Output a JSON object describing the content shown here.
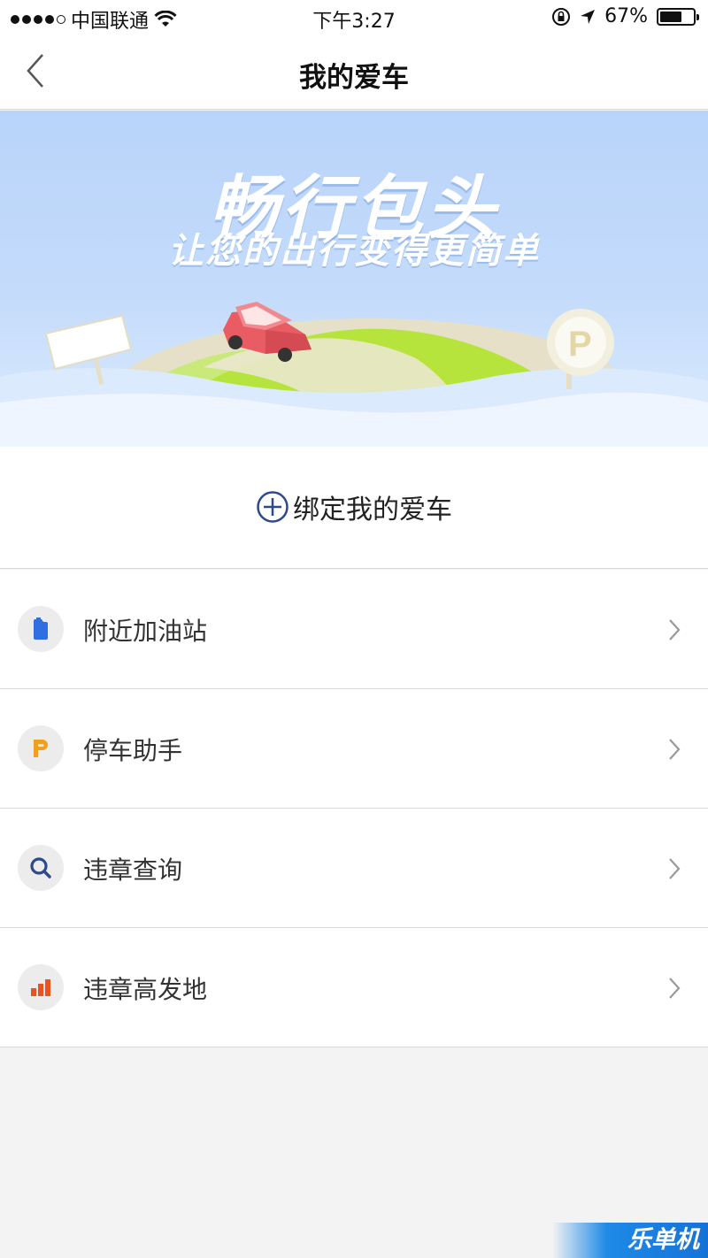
{
  "status_bar": {
    "carrier": "中国联通",
    "time": "下午3:27",
    "battery_text": "67%",
    "battery_level": 0.67,
    "signal_bars_filled": 4,
    "icons": [
      "signal-dots-icon",
      "wifi-icon",
      "orientation-lock-icon",
      "location-arrow-icon",
      "battery-icon"
    ]
  },
  "nav": {
    "title": "我的爱车",
    "back_icon": "chevron-left-icon"
  },
  "banner": {
    "headline": "畅行包头",
    "subline": "让您的出行变得更简单",
    "colors": {
      "sky": "#bcd6fa",
      "hill": "#b5e63a",
      "road": "#e9e3cf",
      "car": "#ea5c64"
    }
  },
  "bind": {
    "label": "绑定我的爱车",
    "icon": "plus-circle-icon",
    "icon_color": "#2c4a8c"
  },
  "menu": [
    {
      "label": "附近加油站",
      "icon": "fuel-can-icon",
      "icon_color": "#2f6fe0"
    },
    {
      "label": "停车助手",
      "icon": "parking-icon",
      "icon_color": "#f0a020"
    },
    {
      "label": "违章查询",
      "icon": "search-icon",
      "icon_color": "#2c4a8c"
    },
    {
      "label": "违章高发地",
      "icon": "bar-chart-icon",
      "icon_color": "#e8531f"
    }
  ],
  "watermark": {
    "text": "乐单机"
  }
}
